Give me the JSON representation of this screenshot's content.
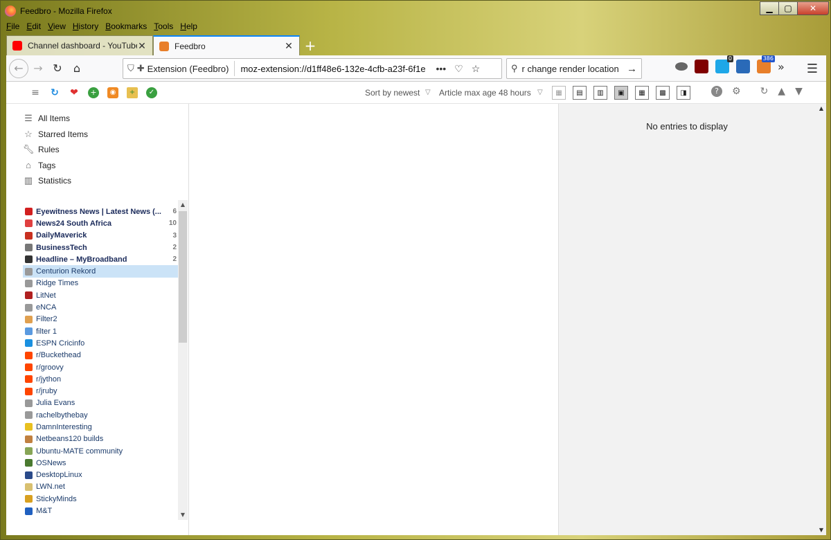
{
  "window": {
    "title": "Feedbro - Mozilla Firefox"
  },
  "menu": [
    "File",
    "Edit",
    "View",
    "History",
    "Bookmarks",
    "Tools",
    "Help"
  ],
  "tabs": [
    {
      "label": "Channel dashboard - YouTube",
      "favicon_color": "#ff0000"
    },
    {
      "label": "Feedbro",
      "favicon_color": "#e87f2a"
    }
  ],
  "urlbar": {
    "identity": "Extension (Feedbro)",
    "url": "moz-extension://d1ff48e6-132e-4cfb-a23f-6f1e"
  },
  "search": {
    "query": "r change render location"
  },
  "extensions": [
    {
      "name": "mask-icon",
      "color": "#555555",
      "badge": ""
    },
    {
      "name": "ublock-icon",
      "color": "#800000",
      "badge": ""
    },
    {
      "name": "ghostery-icon",
      "color": "#1ea7e8",
      "badge": "0"
    },
    {
      "name": "sidebar-ext-icon",
      "color": "#2a6ab8",
      "badge": ""
    },
    {
      "name": "feedbro-ext-icon",
      "color": "#e87f2a",
      "badge": "386"
    }
  ],
  "toolbar": {
    "sort": "Sort by newest",
    "age": "Article max age 48 hours"
  },
  "nav": {
    "all_items": "All Items",
    "starred": "Starred Items",
    "rules": "Rules",
    "tags": "Tags",
    "statistics": "Statistics"
  },
  "feeds": [
    {
      "name": "Eyewitness News | Latest News (...",
      "count": "6",
      "bold": true,
      "color": "#d22020"
    },
    {
      "name": "News24 South Africa",
      "count": "10",
      "bold": true,
      "color": "#e04040"
    },
    {
      "name": "DailyMaverick",
      "count": "3",
      "bold": true,
      "color": "#c83020"
    },
    {
      "name": "BusinessTech",
      "count": "2",
      "bold": true,
      "color": "#777777"
    },
    {
      "name": "Headline – MyBroadband",
      "count": "2",
      "bold": true,
      "color": "#333333"
    },
    {
      "name": "Centurion Rekord",
      "count": "",
      "bold": false,
      "color": "#999999",
      "selected": true
    },
    {
      "name": "Ridge Times",
      "count": "",
      "bold": false,
      "color": "#999999"
    },
    {
      "name": "LitNet",
      "count": "",
      "bold": false,
      "color": "#b02020"
    },
    {
      "name": "eNCA",
      "count": "",
      "bold": false,
      "color": "#999999"
    },
    {
      "name": "Filter2",
      "count": "",
      "bold": false,
      "color": "#e0a050"
    },
    {
      "name": "filter 1",
      "count": "",
      "bold": false,
      "color": "#5a9ae0"
    },
    {
      "name": "ESPN Cricinfo",
      "count": "",
      "bold": false,
      "color": "#1a90e0"
    },
    {
      "name": "r/Buckethead",
      "count": "",
      "bold": false,
      "color": "#ff4500"
    },
    {
      "name": "r/groovy",
      "count": "",
      "bold": false,
      "color": "#ff4500"
    },
    {
      "name": "r/jython",
      "count": "",
      "bold": false,
      "color": "#ff4500"
    },
    {
      "name": "r/jruby",
      "count": "",
      "bold": false,
      "color": "#ff4500"
    },
    {
      "name": "Julia Evans",
      "count": "",
      "bold": false,
      "color": "#999999"
    },
    {
      "name": "rachelbythebay",
      "count": "",
      "bold": false,
      "color": "#999999"
    },
    {
      "name": "DamnInteresting",
      "count": "",
      "bold": false,
      "color": "#e8c020"
    },
    {
      "name": "Netbeans120 builds",
      "count": "",
      "bold": false,
      "color": "#c08040"
    },
    {
      "name": "Ubuntu-MATE community",
      "count": "",
      "bold": false,
      "color": "#87a556"
    },
    {
      "name": "OSNews",
      "count": "",
      "bold": false,
      "color": "#4a7a30"
    },
    {
      "name": "DesktopLinux",
      "count": "",
      "bold": false,
      "color": "#2a4a8a"
    },
    {
      "name": "LWN.net",
      "count": "",
      "bold": false,
      "color": "#d8c070"
    },
    {
      "name": "StickyMinds",
      "count": "",
      "bold": false,
      "color": "#d8a020"
    },
    {
      "name": "M&T",
      "count": "",
      "bold": false,
      "color": "#2060c0"
    }
  ],
  "preview": {
    "empty": "No entries to display"
  }
}
